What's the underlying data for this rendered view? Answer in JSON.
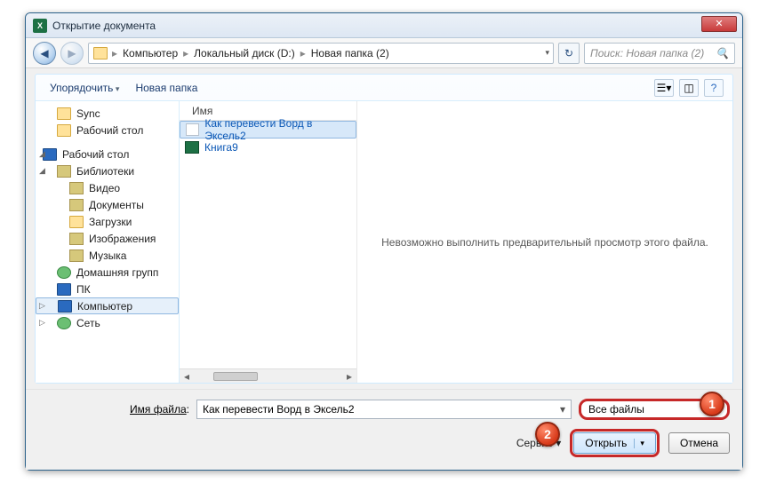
{
  "window": {
    "title": "Открытие документа"
  },
  "nav": {
    "crumbs": [
      "Компьютер",
      "Локальный диск (D:)",
      "Новая папка (2)"
    ],
    "search_placeholder": "Поиск: Новая папка (2)"
  },
  "toolbar": {
    "organize": "Упорядочить",
    "newfolder": "Новая папка"
  },
  "sidebar": {
    "items": [
      {
        "label": "Sync",
        "icon": "folder"
      },
      {
        "label": "Рабочий стол",
        "icon": "folder"
      },
      {
        "label": "Рабочий стол",
        "icon": "monitor",
        "root": true
      },
      {
        "label": "Библиотеки",
        "icon": "lib"
      },
      {
        "label": "Видео",
        "icon": "lib"
      },
      {
        "label": "Документы",
        "icon": "lib"
      },
      {
        "label": "Загрузки",
        "icon": "folder"
      },
      {
        "label": "Изображения",
        "icon": "lib"
      },
      {
        "label": "Музыка",
        "icon": "lib"
      },
      {
        "label": "Домашняя групп",
        "icon": "globe"
      },
      {
        "label": "ПК",
        "icon": "monitor"
      },
      {
        "label": "Компьютер",
        "icon": "monitor",
        "selected": true
      },
      {
        "label": "Сеть",
        "icon": "globe"
      }
    ]
  },
  "filelist": {
    "column": "Имя",
    "items": [
      {
        "name": "Как перевести Ворд в Эксель2",
        "icon": "doc",
        "selected": true
      },
      {
        "name": "Книга9",
        "icon": "xls"
      }
    ]
  },
  "preview": {
    "message": "Невозможно выполнить предварительный просмотр этого файла."
  },
  "form": {
    "filename_label_pre": "Имя файла",
    "filename_value": "Как перевести Ворд в Эксель2",
    "filter": "Все файлы",
    "service": "Сервис",
    "open": "Открыть",
    "cancel": "Отмена"
  },
  "badges": {
    "one": "1",
    "two": "2"
  }
}
